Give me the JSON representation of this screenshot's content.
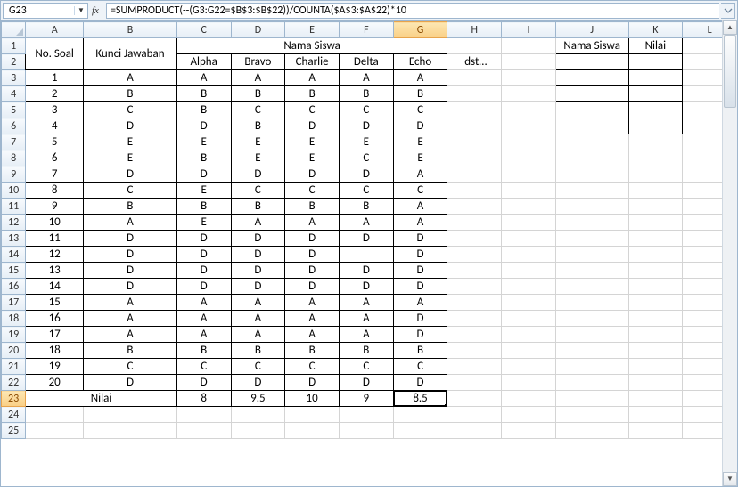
{
  "namebox": "G23",
  "formula": "=SUMPRODUCT(--(G3:G22=$B$3:$B$22))/COUNTA($A$3:$A$22)*10",
  "fx_label": "fx",
  "columns": [
    "A",
    "B",
    "C",
    "D",
    "E",
    "F",
    "G",
    "H",
    "I",
    "J",
    "K",
    "L"
  ],
  "rows": [
    1,
    2,
    3,
    4,
    5,
    6,
    7,
    8,
    9,
    10,
    11,
    12,
    13,
    14,
    15,
    16,
    17,
    18,
    19,
    20,
    21,
    22,
    23,
    24,
    25
  ],
  "headers": {
    "no_soal": "No. Soal",
    "kunci": "Kunci Jawaban",
    "nama_siswa": "Nama Siswa",
    "nilai": "Nilai",
    "dst": "dst…"
  },
  "students": [
    "Alpha",
    "Bravo",
    "Charlie",
    "Delta",
    "Echo"
  ],
  "key": [
    "A",
    "B",
    "C",
    "D",
    "E",
    "E",
    "D",
    "C",
    "B",
    "A",
    "D",
    "D",
    "D",
    "D",
    "A",
    "A",
    "A",
    "B",
    "C",
    "D"
  ],
  "answers": {
    "Alpha": [
      "A",
      "B",
      "B",
      "D",
      "E",
      "B",
      "D",
      "E",
      "B",
      "E",
      "D",
      "D",
      "D",
      "D",
      "A",
      "A",
      "A",
      "B",
      "C",
      "D"
    ],
    "Bravo": [
      "A",
      "B",
      "C",
      "B",
      "E",
      "E",
      "D",
      "C",
      "B",
      "A",
      "D",
      "D",
      "D",
      "D",
      "A",
      "A",
      "A",
      "B",
      "C",
      "D"
    ],
    "Charlie": [
      "A",
      "B",
      "C",
      "D",
      "E",
      "E",
      "D",
      "C",
      "B",
      "A",
      "D",
      "D",
      "D",
      "D",
      "A",
      "A",
      "A",
      "B",
      "C",
      "D"
    ],
    "Delta": [
      "A",
      "B",
      "C",
      "D",
      "E",
      "C",
      "D",
      "C",
      "B",
      "A",
      "D",
      "",
      "D",
      "D",
      "A",
      "A",
      "A",
      "B",
      "C",
      "D"
    ],
    "Echo": [
      "A",
      "B",
      "C",
      "D",
      "E",
      "E",
      "A",
      "C",
      "A",
      "A",
      "D",
      "D",
      "D",
      "D",
      "A",
      "D",
      "D",
      "B",
      "C",
      "D"
    ]
  },
  "scores": {
    "Alpha": "8",
    "Bravo": "9.5",
    "Charlie": "10",
    "Delta": "9",
    "Echo": "8.5"
  },
  "side_table": {
    "nama_siswa": "Nama Siswa",
    "nilai": "Nilai"
  },
  "active_cell": "G23",
  "selected_col": "G",
  "selected_row": 23
}
